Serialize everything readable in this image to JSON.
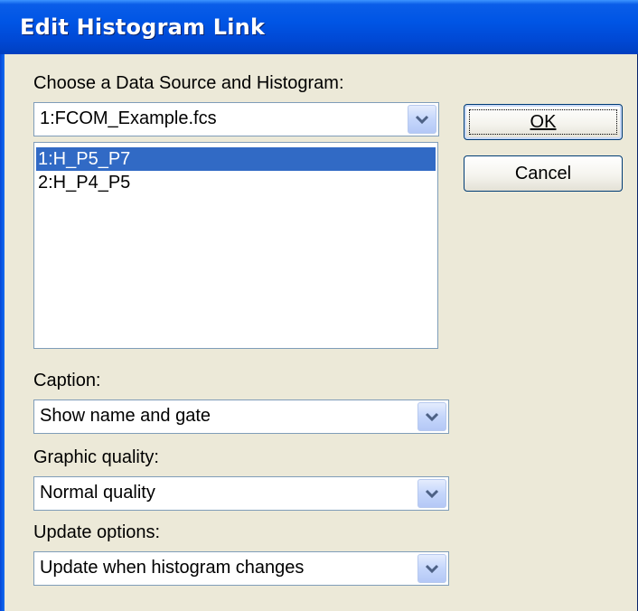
{
  "window": {
    "title": "Edit Histogram Link"
  },
  "source": {
    "label": "Choose a Data Source and Histogram:",
    "selected": "1:FCOM_Example.fcs",
    "arrow_icon": "chevron-down-icon"
  },
  "histograms": [
    {
      "label": "1:H_P5_P7",
      "selected": true
    },
    {
      "label": "2:H_P4_P5",
      "selected": false
    }
  ],
  "buttons": {
    "ok_label": "OK",
    "cancel_label": "Cancel"
  },
  "caption": {
    "label": "Caption:",
    "selected": "Show name and gate"
  },
  "quality": {
    "label": "Graphic quality:",
    "selected": "Normal quality"
  },
  "update": {
    "label": "Update options:",
    "selected": "Update when histogram changes"
  },
  "colors": {
    "title_bar": "#0055e5",
    "selection": "#316ac5",
    "dialog_bg": "#ece9d8"
  }
}
